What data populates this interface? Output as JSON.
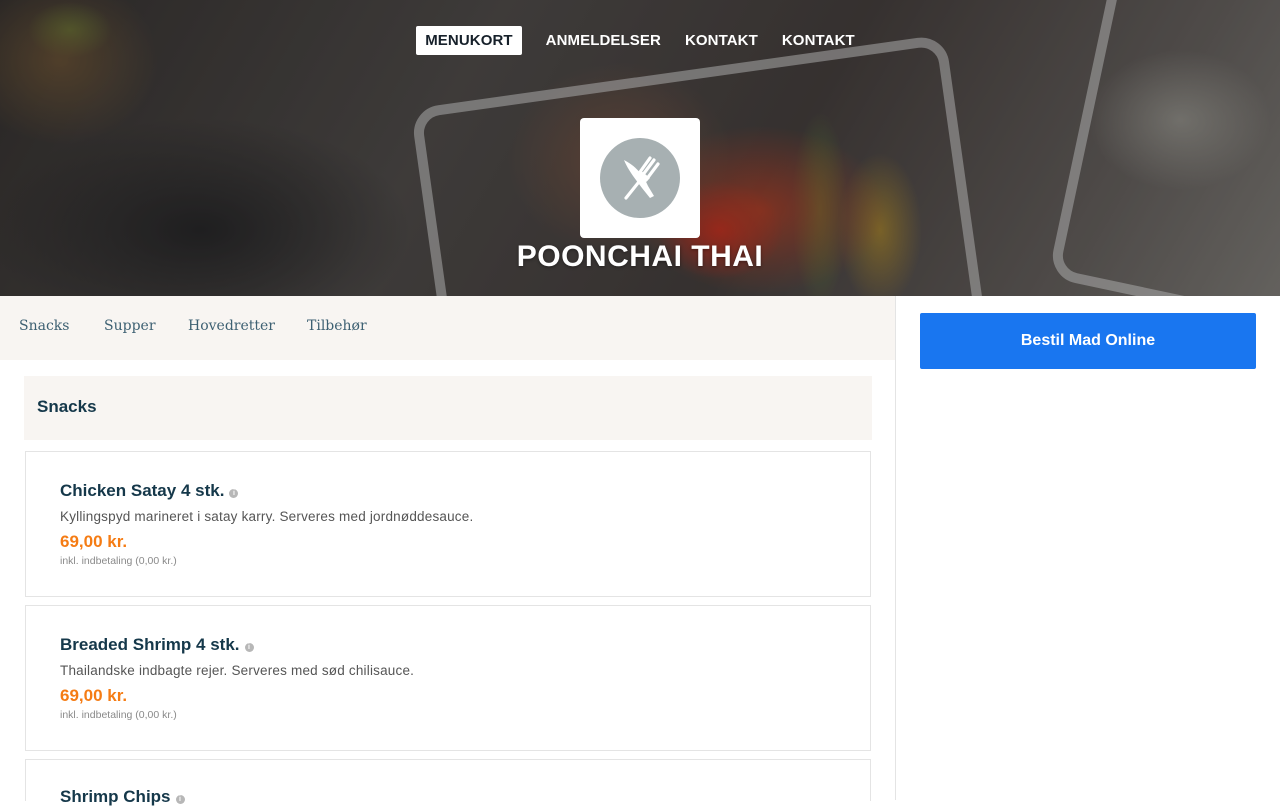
{
  "nav": {
    "items": [
      {
        "label": "MENUKORT",
        "active": true
      },
      {
        "label": "ANMELDELSER",
        "active": false
      },
      {
        "label": "KONTAKT",
        "active": false
      },
      {
        "label": "KONTAKT",
        "active": false
      }
    ]
  },
  "restaurant": {
    "name": "POONCHAI THAI",
    "logo_icon": "fork-knife-icon"
  },
  "categories": [
    "Snacks",
    "Supper",
    "Hovedretter",
    "Tilbehør"
  ],
  "section": {
    "title": "Snacks",
    "items": [
      {
        "name": "Chicken Satay 4 stk.",
        "description": "Kyllingspyd marineret i satay karry. Serveres med jordnøddesauce.",
        "price": "69,00 kr.",
        "deposit": "inkl. indbetaling (0,00 kr.)"
      },
      {
        "name": "Breaded Shrimp 4 stk.",
        "description": "Thailandske indbagte rejer. Serveres med sød chilisauce.",
        "price": "69,00 kr.",
        "deposit": "inkl. indbetaling (0,00 kr.)"
      },
      {
        "name": "Shrimp Chips",
        "description": "",
        "price": "",
        "deposit": ""
      }
    ]
  },
  "order": {
    "button_label": "Bestil Mad Online"
  },
  "colors": {
    "accent_blue": "#1976f0",
    "price_orange": "#f57c14",
    "heading_navy": "#15384a",
    "category_bar_bg": "#f8f5f2"
  }
}
